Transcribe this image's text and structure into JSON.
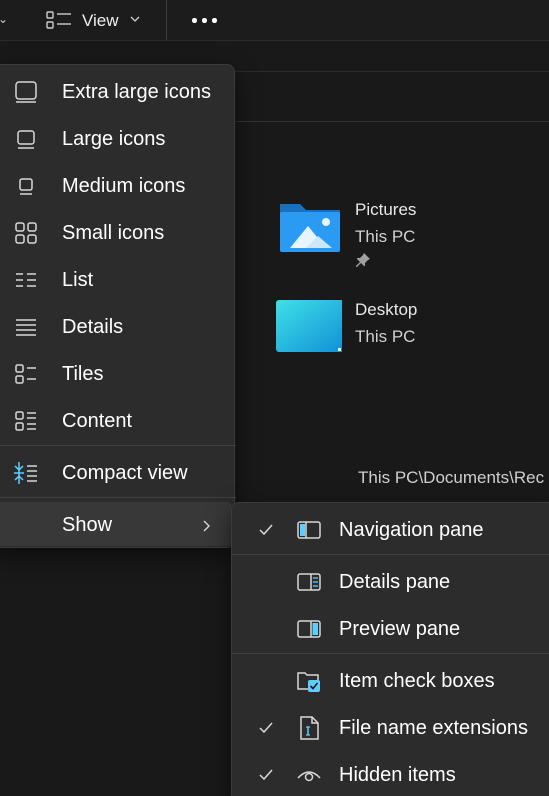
{
  "toolbar": {
    "view_label": "View",
    "view_icon": "view-list-icon",
    "more_icon": "more-options-icon"
  },
  "quick_access": [
    {
      "name": "Pictures",
      "location": "This PC",
      "pinned": true,
      "icon": "pictures-folder-icon"
    },
    {
      "name": "Desktop",
      "location": "This PC",
      "pinned": false,
      "icon": "desktop-folder-icon"
    }
  ],
  "path_text": "This PC\\Documents\\Rec",
  "view_menu": {
    "items": [
      {
        "label": "Extra large icons",
        "icon": "extra-large-icons-icon"
      },
      {
        "label": "Large icons",
        "icon": "large-icons-icon"
      },
      {
        "label": "Medium icons",
        "icon": "medium-icons-icon"
      },
      {
        "label": "Small icons",
        "icon": "small-icons-icon"
      },
      {
        "label": "List",
        "icon": "list-icon"
      },
      {
        "label": "Details",
        "icon": "details-icon"
      },
      {
        "label": "Tiles",
        "icon": "tiles-icon"
      },
      {
        "label": "Content",
        "icon": "content-icon"
      }
    ],
    "compact_view": {
      "label": "Compact view",
      "icon": "compact-view-icon"
    },
    "show": {
      "label": "Show",
      "icon": "chevron-right-icon"
    }
  },
  "show_menu": {
    "items": [
      {
        "label": "Navigation pane",
        "checked": true,
        "icon": "navigation-pane-icon"
      },
      {
        "label": "Details pane",
        "checked": false,
        "icon": "details-pane-icon"
      },
      {
        "label": "Preview pane",
        "checked": false,
        "icon": "preview-pane-icon"
      },
      {
        "label": "Item check boxes",
        "checked": false,
        "icon": "item-check-boxes-icon"
      },
      {
        "label": "File name extensions",
        "checked": true,
        "icon": "file-name-extensions-icon"
      },
      {
        "label": "Hidden items",
        "checked": true,
        "icon": "hidden-items-icon"
      }
    ]
  },
  "colors": {
    "background": "#191919",
    "menu_background": "#2c2c2c",
    "accent": "#60cdff",
    "text": "#ffffff"
  }
}
